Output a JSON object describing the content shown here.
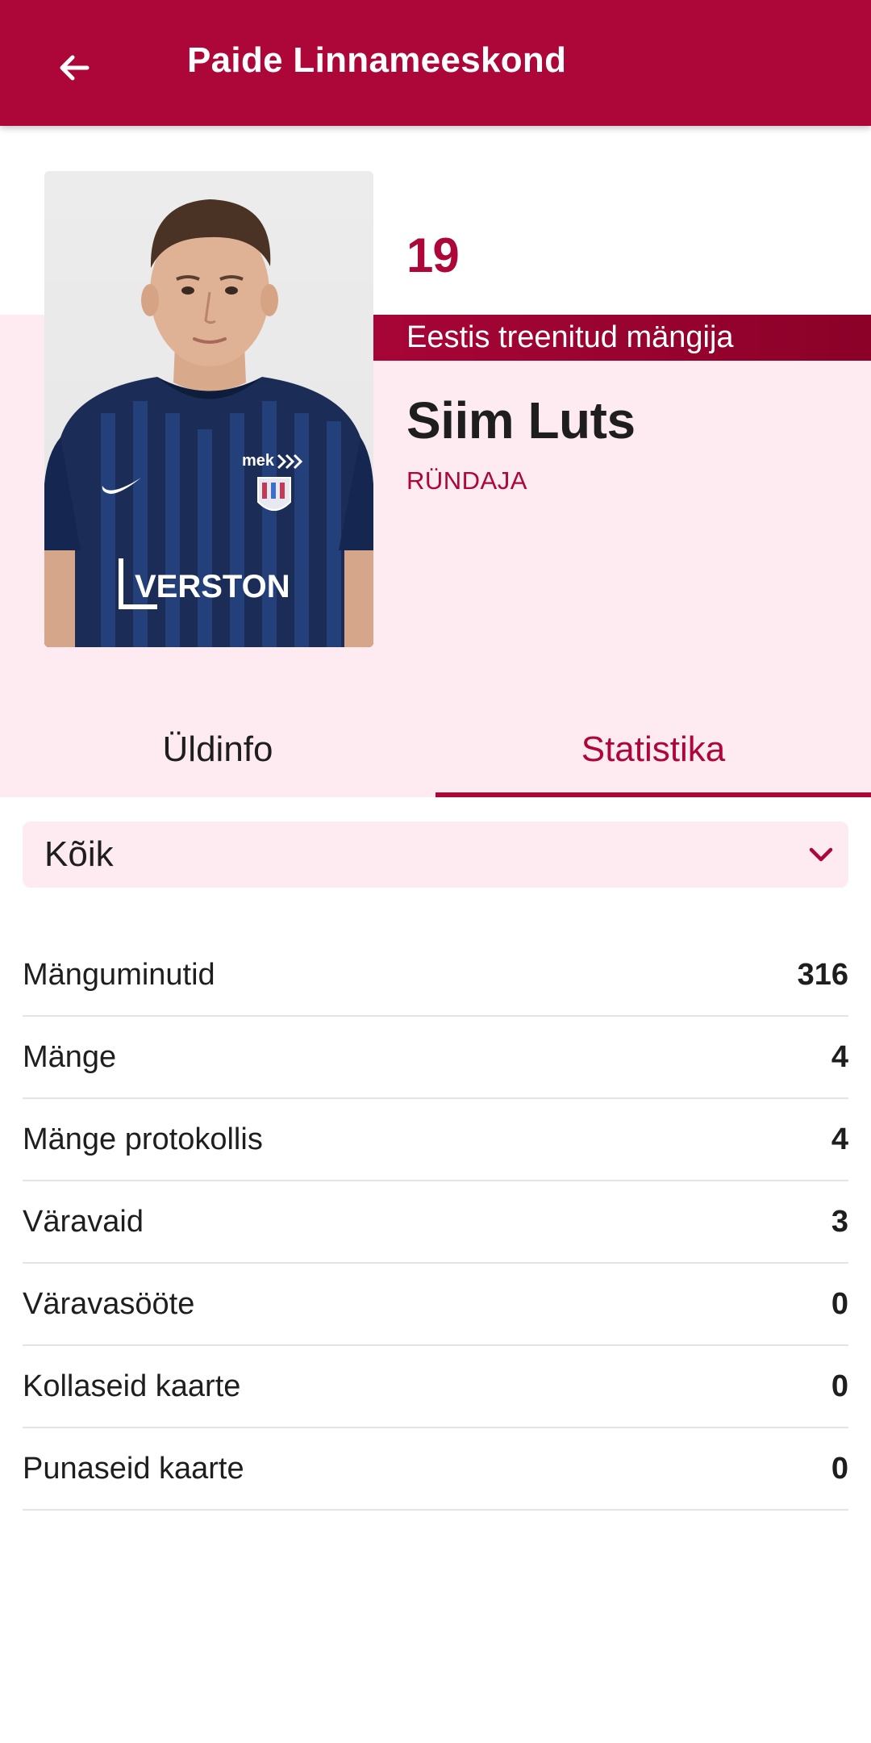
{
  "header": {
    "title": "Paide Linnameeskond",
    "back_icon": "arrow-left-icon"
  },
  "player": {
    "number": "19",
    "badge": "Eestis treenitud mängija",
    "name": "Siim Luts",
    "position": "RÜNDAJA",
    "photo": {
      "sponsor_chest": "VERSTON",
      "sponsor_top": "mek"
    }
  },
  "tabs": [
    {
      "label": "Üldinfo",
      "active": false
    },
    {
      "label": "Statistika",
      "active": true
    }
  ],
  "filter": {
    "value": "Kõik",
    "icon": "chevron-down-icon"
  },
  "stats": [
    {
      "label": "Mänguminutid",
      "value": "316"
    },
    {
      "label": "Mänge",
      "value": "4"
    },
    {
      "label": "Mänge protokollis",
      "value": "4"
    },
    {
      "label": "Väravaid",
      "value": "3"
    },
    {
      "label": "Väravasööte",
      "value": "0"
    },
    {
      "label": "Kollaseid kaarte",
      "value": "0"
    },
    {
      "label": "Punaseid kaarte",
      "value": "0"
    }
  ],
  "colors": {
    "primary": "#ad0639",
    "light_pink": "#fdebf1",
    "text": "#1e1e1e",
    "divider": "#e4e4e4"
  }
}
